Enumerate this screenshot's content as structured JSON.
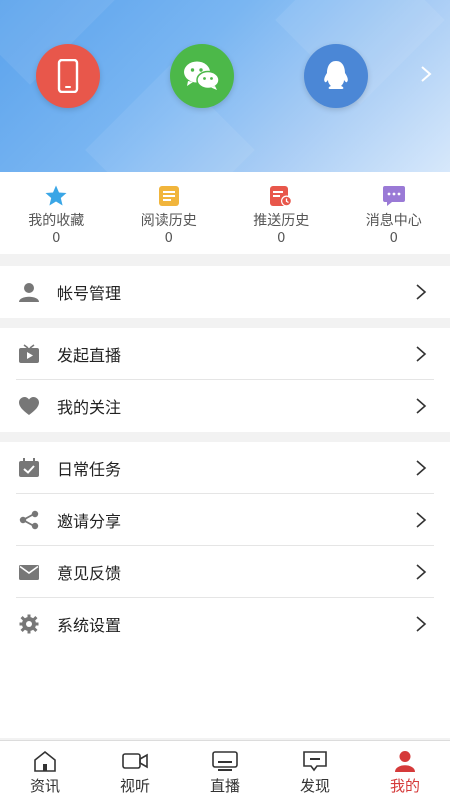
{
  "colors": {
    "accent": "#d53a3a",
    "phone": "#e8574b",
    "wechat": "#4cb849",
    "qq": "#4b87d6",
    "star": "#3aa6e6",
    "read": "#f1b53c",
    "push": "#e8574b",
    "msg": "#9a7ad6",
    "icon_gray": "#777777"
  },
  "login": [
    {
      "name": "phone-login-button",
      "icon": "phone-icon"
    },
    {
      "name": "wechat-login-button",
      "icon": "wechat-icon"
    },
    {
      "name": "qq-login-button",
      "icon": "qq-icon"
    }
  ],
  "stats": [
    {
      "label": "我的收藏",
      "count": "0",
      "icon": "star-icon"
    },
    {
      "label": "阅读历史",
      "count": "0",
      "icon": "reading-history-icon"
    },
    {
      "label": "推送历史",
      "count": "0",
      "icon": "push-history-icon"
    },
    {
      "label": "消息中心",
      "count": "0",
      "icon": "message-center-icon"
    }
  ],
  "menu": {
    "account": {
      "label": "帐号管理",
      "icon": "person-icon"
    },
    "live": {
      "label": "发起直播",
      "icon": "tv-icon"
    },
    "follow": {
      "label": "我的关注",
      "icon": "heart-icon"
    },
    "tasks": {
      "label": "日常任务",
      "icon": "calendar-check-icon"
    },
    "share": {
      "label": "邀请分享",
      "icon": "share-icon"
    },
    "feedback": {
      "label": "意见反馈",
      "icon": "mail-icon"
    },
    "settings": {
      "label": "系统设置",
      "icon": "gear-icon"
    }
  },
  "tabs": [
    {
      "label": "资讯",
      "icon": "home-icon",
      "active": false
    },
    {
      "label": "视听",
      "icon": "video-icon",
      "active": false
    },
    {
      "label": "直播",
      "icon": "live-screen-icon",
      "active": false
    },
    {
      "label": "发现",
      "icon": "discover-icon",
      "active": false
    },
    {
      "label": "我的",
      "icon": "profile-icon",
      "active": true
    }
  ]
}
